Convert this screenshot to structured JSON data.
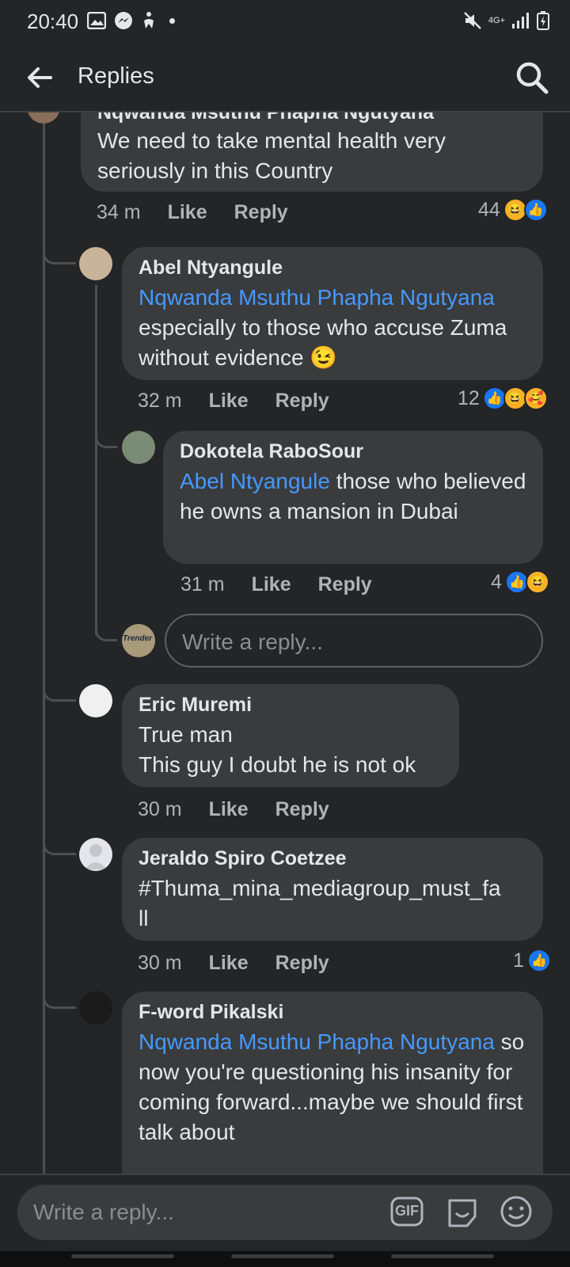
{
  "status": {
    "time": "20:40",
    "network": "4G+"
  },
  "header": {
    "title": "Replies"
  },
  "comments": [
    {
      "name": "Nqwanda Msuthu Phapha Ngutyana",
      "text": "We need to take mental health very seriously in this Country",
      "time": "34 m",
      "like": "Like",
      "reply": "Reply",
      "reactions": "44"
    },
    {
      "name": "Abel Ntyangule",
      "mention": "Nqwanda Msuthu Phapha Ngutyana",
      "text": "especially to those who accuse Zuma without evidence 😉",
      "time": "32 m",
      "like": "Like",
      "reply": "Reply",
      "reactions": "12"
    },
    {
      "name": "Dokotela RaboSour",
      "mention": "Abel Ntyangule",
      "text": "those who believed he owns a mansion in Dubai",
      "time": "31 m",
      "like": "Like",
      "reply": "Reply",
      "reactions": "4"
    },
    {
      "name": "Eric Muremi",
      "text1": "True man",
      "text2": "This guy I doubt he is not ok",
      "time": "30 m",
      "like": "Like",
      "reply": "Reply"
    },
    {
      "name": "Jeraldo Spiro Coetzee",
      "text1": "#Thuma_mina_mediagroup_must_fa",
      "text2": "ll",
      "time": "30 m",
      "like": "Like",
      "reply": "Reply",
      "reactions": "1"
    },
    {
      "name": "F-word Pikalski",
      "mention": "Nqwanda Msuthu Phapha Ngutyana",
      "text": "so now you're questioning his insanity for coming forward...maybe we should first talk about"
    }
  ],
  "inline_reply": {
    "placeholder": "Write a reply..."
  },
  "composer": {
    "placeholder": "Write a reply...",
    "gif_label": "GIF"
  },
  "avatar_text": {
    "trender": "Trender"
  }
}
